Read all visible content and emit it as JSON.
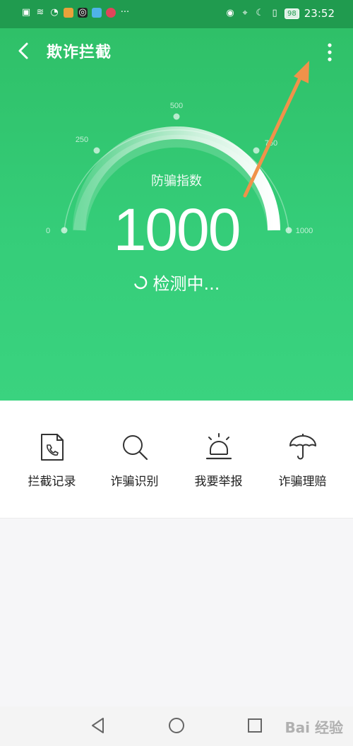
{
  "status_bar": {
    "time": "23:52",
    "battery": "98",
    "left_icons": [
      "alert-icon",
      "wifi-icon",
      "speed-icon",
      "app-icon",
      "camera-icon",
      "gallery-icon",
      "face-icon",
      "more-dots-icon"
    ],
    "right_icons": [
      "eye-icon",
      "location-icon",
      "moon-icon",
      "vibrate-icon"
    ]
  },
  "app_bar": {
    "title": "欺诈拦截",
    "back_icon": "back-arrow-icon",
    "more_icon": "more-vertical-icon"
  },
  "gauge": {
    "label": "防骗指数",
    "value": "1000",
    "status": "检测中...",
    "ticks": [
      "0",
      "250",
      "500",
      "750",
      "1000"
    ],
    "level": 1.0
  },
  "quick_actions": [
    {
      "label": "拦截记录",
      "icon": "call-record-icon"
    },
    {
      "label": "诈骗识别",
      "icon": "search-icon"
    },
    {
      "label": "我要举报",
      "icon": "alarm-icon"
    },
    {
      "label": "诈骗理赔",
      "icon": "umbrella-icon"
    }
  ],
  "nav": {
    "icons": [
      "nav-back-icon",
      "nav-home-icon",
      "nav-recent-icon"
    ]
  },
  "watermark": "Bai 经验",
  "colors": {
    "header_green": "#209b4f",
    "hero_green": "#35cd79",
    "annotation_arrow": "#f0924a"
  }
}
